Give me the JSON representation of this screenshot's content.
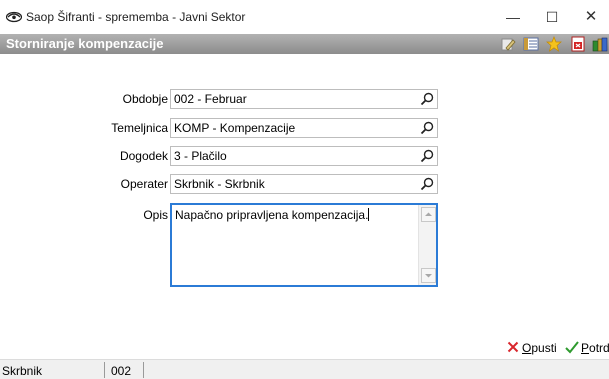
{
  "window": {
    "title": "Saop Šifranti - sprememba - Javni Sektor",
    "controls": {
      "minimize": "—",
      "maximize": "☐",
      "close": "✕"
    },
    "icon": "eye-logo-icon"
  },
  "header": {
    "title": "Storniranje kompenzacije",
    "toolbar_icons": [
      "edit-note-icon",
      "columns-icon",
      "star-icon",
      "pdf-icon",
      "books-icon"
    ]
  },
  "form": {
    "obdobje": {
      "label": "Obdobje",
      "value": "002 - Februar"
    },
    "temeljnica": {
      "label": "Temeljnica",
      "value": "KOMP - Kompenzacije"
    },
    "dogodek": {
      "label": "Dogodek",
      "value": "3 - Plačilo"
    },
    "operater": {
      "label": "Operater",
      "value": "Skrbnik - Skrbnik"
    },
    "opis": {
      "label": "Opis",
      "value": "Napačno pripravljena kompenzacija."
    }
  },
  "actions": {
    "cancel": {
      "accel": "O",
      "rest": "pusti"
    },
    "confirm": {
      "accel": "P",
      "rest": "otrdi"
    }
  },
  "status": {
    "user": "Skrbnik",
    "period": "002"
  },
  "colors": {
    "header_bar": "#9e9e9e",
    "focus_border": "#2b7bd6",
    "cancel_red": "#d9262c",
    "confirm_green": "#2e9a2e"
  }
}
